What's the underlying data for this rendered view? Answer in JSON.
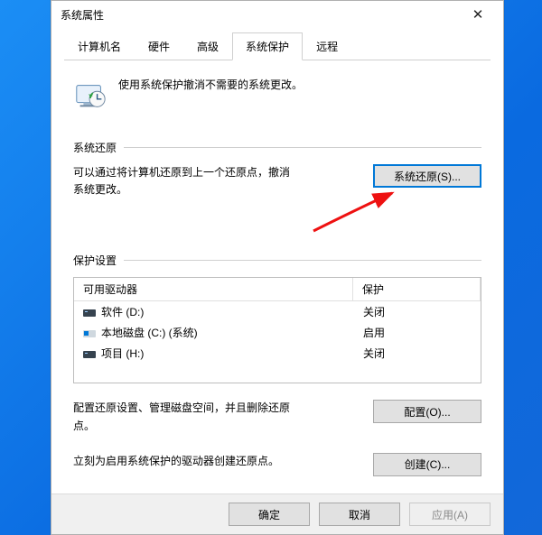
{
  "window": {
    "title": "系统属性",
    "tabs": [
      "计算机名",
      "硬件",
      "高级",
      "系统保护",
      "远程"
    ],
    "active_tab_index": 3
  },
  "intro": "使用系统保护撤消不需要的系统更改。",
  "restore_section": {
    "heading": "系统还原",
    "desc": "可以通过将计算机还原到上一个还原点，撤消系统更改。",
    "button": "系统还原(S)..."
  },
  "protection_section": {
    "heading": "保护设置",
    "col_drive": "可用驱动器",
    "col_prot": "保护",
    "drives": [
      {
        "name": "软件 (D:)",
        "prot": "关闭",
        "icon": "drive-dark"
      },
      {
        "name": "本地磁盘 (C:) (系统)",
        "prot": "启用",
        "icon": "drive-win"
      },
      {
        "name": "项目 (H:)",
        "prot": "关闭",
        "icon": "drive-dark"
      }
    ],
    "configure_desc": "配置还原设置、管理磁盘空间，并且删除还原点。",
    "configure_btn": "配置(O)...",
    "create_desc": "立刻为启用系统保护的驱动器创建还原点。",
    "create_btn": "创建(C)..."
  },
  "footer": {
    "ok": "确定",
    "cancel": "取消",
    "apply": "应用(A)"
  }
}
